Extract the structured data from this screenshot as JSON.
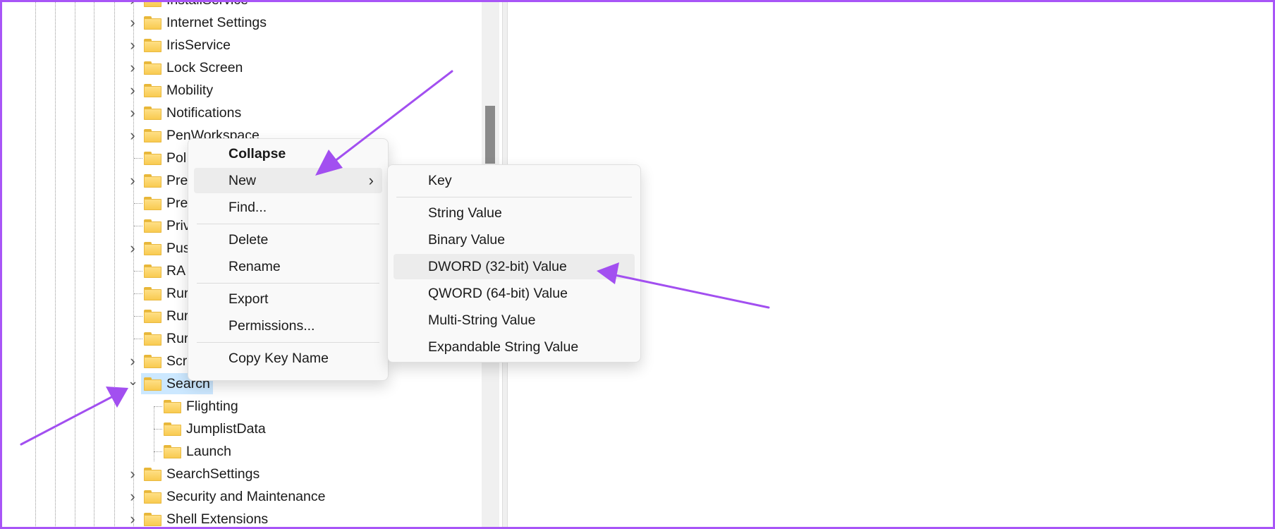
{
  "tree": {
    "rows": [
      {
        "label": "InstallService",
        "expander": "collapsed",
        "level": 0
      },
      {
        "label": "Internet Settings",
        "expander": "collapsed",
        "level": 0
      },
      {
        "label": "IrisService",
        "expander": "collapsed",
        "level": 0
      },
      {
        "label": "Lock Screen",
        "expander": "collapsed",
        "level": 0
      },
      {
        "label": "Mobility",
        "expander": "collapsed",
        "level": 0
      },
      {
        "label": "Notifications",
        "expander": "collapsed",
        "level": 0
      },
      {
        "label": "PenWorkspace",
        "expander": "collapsed",
        "level": 0
      },
      {
        "label": "Pol",
        "expander": "none",
        "level": 0
      },
      {
        "label": "Pre",
        "expander": "collapsed",
        "level": 0
      },
      {
        "label": "Pre",
        "expander": "none",
        "level": 0
      },
      {
        "label": "Priv",
        "expander": "none",
        "level": 0
      },
      {
        "label": "Pus",
        "expander": "collapsed",
        "level": 0
      },
      {
        "label": "RA",
        "expander": "none",
        "level": 0
      },
      {
        "label": "Rur",
        "expander": "none",
        "level": 0
      },
      {
        "label": "Rur",
        "expander": "none",
        "level": 0
      },
      {
        "label": "Rur",
        "expander": "none",
        "level": 0
      },
      {
        "label": "Scr",
        "expander": "collapsed",
        "level": 0
      },
      {
        "label": "Search",
        "expander": "expanded",
        "level": 0,
        "selected": true
      },
      {
        "label": "Flighting",
        "expander": "none",
        "level": 1
      },
      {
        "label": "JumplistData",
        "expander": "none",
        "level": 1
      },
      {
        "label": "Launch",
        "expander": "none",
        "level": 1
      },
      {
        "label": "SearchSettings",
        "expander": "collapsed",
        "level": 0
      },
      {
        "label": "Security and Maintenance",
        "expander": "collapsed",
        "level": 0
      },
      {
        "label": "Shell Extensions",
        "expander": "collapsed",
        "level": 0
      }
    ]
  },
  "context_menu": {
    "items": [
      {
        "label": "Collapse",
        "bold": true
      },
      {
        "label": "New",
        "submenu": true,
        "highlighted": true
      },
      {
        "label": "Find..."
      },
      {
        "separator": true
      },
      {
        "label": "Delete"
      },
      {
        "label": "Rename"
      },
      {
        "separator": true
      },
      {
        "label": "Export"
      },
      {
        "label": "Permissions..."
      },
      {
        "separator": true
      },
      {
        "label": "Copy Key Name"
      }
    ]
  },
  "submenu": {
    "items": [
      {
        "label": "Key"
      },
      {
        "separator": true
      },
      {
        "label": "String Value"
      },
      {
        "label": "Binary Value"
      },
      {
        "label": "DWORD (32-bit) Value",
        "highlighted": true
      },
      {
        "label": "QWORD (64-bit) Value"
      },
      {
        "label": "Multi-String Value"
      },
      {
        "label": "Expandable String Value"
      }
    ]
  },
  "colors": {
    "annotation_arrow": "#a24ff0",
    "frame": "#a855f7",
    "selection": "#cce8ff",
    "folder": "#f8c94c"
  },
  "icons": {
    "expander_collapsed": "chevron-right-icon",
    "expander_expanded": "chevron-down-icon",
    "folder": "folder-icon",
    "submenu": "chevron-right-icon"
  }
}
